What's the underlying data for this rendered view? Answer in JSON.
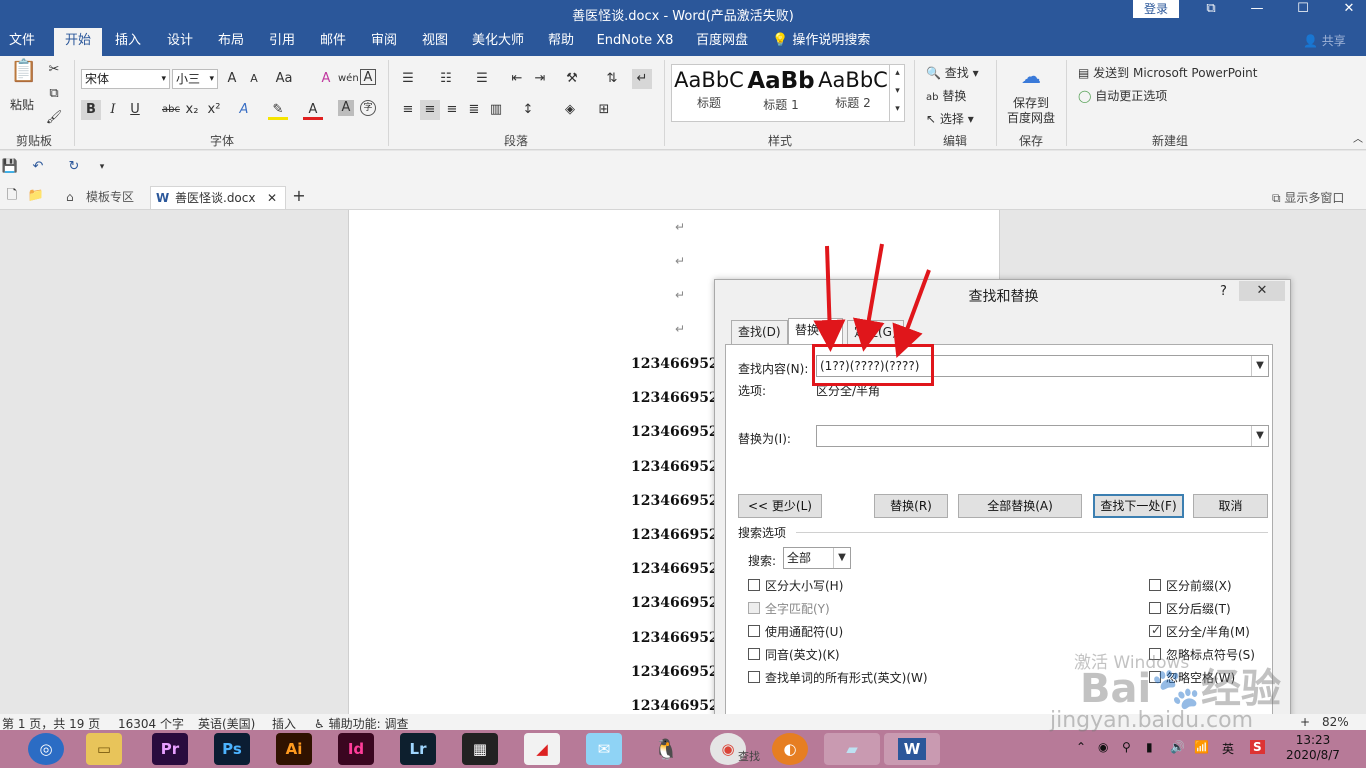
{
  "window": {
    "title": "善医怪谈.docx  -  Word(产品激活失败)",
    "login_label": "登录",
    "controls": [
      "⧉",
      "—",
      "☐",
      "✕"
    ]
  },
  "ribbon_tabs": [
    "文件",
    "开始",
    "插入",
    "设计",
    "布局",
    "引用",
    "邮件",
    "审阅",
    "视图",
    "美化大师",
    "帮助",
    "EndNote X8",
    "百度网盘"
  ],
  "tell_me": "操作说明搜索",
  "share_label": "共享",
  "clipboard": {
    "paste_label": "粘贴",
    "group": "剪贴板"
  },
  "font": {
    "name": "宋体",
    "size": "小三",
    "group": "字体",
    "bold": "B",
    "italic": "I",
    "underline": "U",
    "strike": "abc",
    "sub": "x₂",
    "sup": "x²",
    "grow": "A",
    "shrink": "A",
    "case": "Aa",
    "clear": "A",
    "phonetic": "wén",
    "border": "A",
    "color": "A",
    "shade": "A",
    "circled": "字"
  },
  "paragraph": {
    "group": "段落"
  },
  "styles": {
    "group": "样式",
    "items": [
      {
        "sample": "AaBbC",
        "name": "标题"
      },
      {
        "sample": "AaBb",
        "name": "标题 1"
      },
      {
        "sample": "AaBbC",
        "name": "标题 2"
      }
    ]
  },
  "editing": {
    "group": "编辑",
    "find": "查找",
    "replace": "替换",
    "select": "选择"
  },
  "save_group": {
    "group": "保存",
    "label_line1": "保存到",
    "label_line2": "百度网盘"
  },
  "new_group": {
    "group": "新建组",
    "send_to_ppt": "发送到 Microsoft PowerPoint",
    "autocorrect": "自动更正选项"
  },
  "doc_tabs": {
    "template_zone": "模板专区",
    "document": "善医怪谈.docx",
    "show_multi": "显示多窗口",
    "add": "+"
  },
  "document": {
    "para_mark": "↵",
    "lines": [
      "1234669523",
      "1234669523",
      "1234669523",
      "1234669523",
      "1234669523",
      "1234669523",
      "1234669523",
      "1234669523",
      "1234669523",
      "1234669523",
      "1234669523"
    ]
  },
  "dialog": {
    "title": "查找和替换",
    "help": "?",
    "close": "✕",
    "tabs": [
      "查找(D)",
      "替换(P)",
      "定位(G)"
    ],
    "find_label": "查找内容(N):",
    "find_value": "(1??)(????)(????)",
    "options_label": "选项:",
    "options_value": "区分全/半角",
    "replace_label": "替换为(I):",
    "replace_value": "",
    "buttons": {
      "less": "<< 更少(L)",
      "replace": "替换(R)",
      "replace_all": "全部替换(A)",
      "find_next": "查找下一处(F)",
      "cancel": "取消"
    },
    "search_options_title": "搜索选项",
    "search_label": "搜索:",
    "search_value": "全部",
    "checks_left": [
      {
        "label": "区分大小写(H)",
        "checked": false,
        "disabled": false
      },
      {
        "label": "全字匹配(Y)",
        "checked": false,
        "disabled": true
      },
      {
        "label": "使用通配符(U)",
        "checked": false,
        "disabled": false
      },
      {
        "label": "同音(英文)(K)",
        "checked": false,
        "disabled": false
      },
      {
        "label": "查找单词的所有形式(英文)(W)",
        "checked": false,
        "disabled": false
      }
    ],
    "checks_right": [
      {
        "label": "区分前缀(X)",
        "checked": false,
        "disabled": false
      },
      {
        "label": "区分后缀(T)",
        "checked": false,
        "disabled": false
      },
      {
        "label": "区分全/半角(M)",
        "checked": true,
        "disabled": false
      },
      {
        "label": "忽略标点符号(S)",
        "checked": false,
        "disabled": false
      },
      {
        "label": "忽略空格(W)",
        "checked": false,
        "disabled": false
      }
    ]
  },
  "status": {
    "page": "第 1 页，共 19 页",
    "words": "16304 个字",
    "language": "英语(美国)",
    "mode": "插入",
    "accessibility": "辅助功能: 调查",
    "zoom": "82%",
    "zoom_minus": "-",
    "zoom_plus": "+"
  },
  "taskbar": {
    "apps": [
      "Pr",
      "Ps",
      "Ai",
      "Id",
      "Lr"
    ],
    "time": "13:23",
    "date": "2020/8/7",
    "ime": "英",
    "find_hint": "查找"
  },
  "watermark": {
    "line1": "Bai",
    "line2": "经验",
    "url": "jingyan.baidu.com",
    "activate": "激活 Windows"
  },
  "colors": {
    "ribbon_blue": "#2b579a",
    "annotation_red": "#e0161b",
    "taskbar": "#b77a98"
  }
}
